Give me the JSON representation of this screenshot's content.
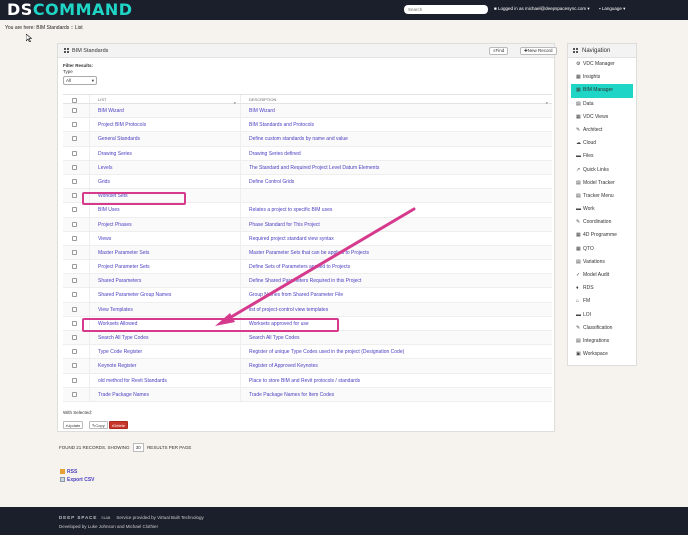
{
  "app": {
    "logo_part1": "DS",
    "logo_part2": "COMMAND",
    "search_placeholder": "Search",
    "user_text": "Logged in as michael@deepspacesync.com",
    "language_label": "Language"
  },
  "breadcrumb": {
    "prefix": "You are here:",
    "path": "BIM Standards :: List"
  },
  "panel": {
    "title": "BIM Standards",
    "find_label": "Find",
    "new_label": "New Record",
    "filter_title": "Filter Results:",
    "type_label": "Type",
    "type_value": "All"
  },
  "table": {
    "col_list": "LIST",
    "col_desc": "DESCRIPTION",
    "rows": [
      {
        "list": "BIM Wizard",
        "desc": "BIM Wizard"
      },
      {
        "list": "Project BIM Protocols",
        "desc": "BIM Standards and Protocols"
      },
      {
        "list": "General Standards",
        "desc": "Define custom standards by name and value"
      },
      {
        "list": "Drawing Series",
        "desc": "Drawing Series defined"
      },
      {
        "list": "Levels",
        "desc": "The Standard and Required Project Level Datum Elements"
      },
      {
        "list": "Grids",
        "desc": "Define Control Grids"
      },
      {
        "list": "Workset Sets",
        "desc": ""
      },
      {
        "list": "BIM Uses",
        "desc": "Relates a project to specific BIM uses"
      },
      {
        "list": "Project Phases",
        "desc": "Phase Standard for This Project"
      },
      {
        "list": "Views",
        "desc": "Required project standard view syntax"
      },
      {
        "list": "Master Parameter Sets",
        "desc": "Master Parameter Sets that can be applied to Projects"
      },
      {
        "list": "Project Parameter Sets",
        "desc": "Define Sets of Parameters applied to Projects"
      },
      {
        "list": "Shared Parameters",
        "desc": "Define Shared Parameters Required in this Project"
      },
      {
        "list": "Shared Parameter Group Names",
        "desc": "Group Names from Shared Parameter File"
      },
      {
        "list": "View Templates",
        "desc": "list of project-control view templates"
      },
      {
        "list": "Worksets Allowed",
        "desc": "Worksets approved for use"
      },
      {
        "list": "Search All Type Codes",
        "desc": "Search All Type Codes"
      },
      {
        "list": "Type Code Register",
        "desc": "Register of unique Type Codes used in the project (Designation Code)"
      },
      {
        "list": "Keynote Register",
        "desc": "Register of Approved Keynotes"
      },
      {
        "list": "old method for Revit Standards",
        "desc": "Place to store BIM and Revit protocols / standards"
      },
      {
        "list": "Trade Package Names",
        "desc": "Trade Package Names for Item Codes"
      }
    ]
  },
  "selection": {
    "with_selected": "With Selected:",
    "update": "Update",
    "copy": "Copy",
    "delete": "Delete"
  },
  "pager": {
    "found_text": "FOUND 21 RECORDS. SHOWING",
    "per_page": "30",
    "suffix": "RESULTS PER PAGE"
  },
  "exports": {
    "rss": "RSS",
    "csv": "Export CSV"
  },
  "nav": {
    "title": "Navigation",
    "items": [
      {
        "label": "VDC Manager",
        "icon": "⚙"
      },
      {
        "label": "Insights",
        "icon": "▦"
      },
      {
        "label": "BIM Manager",
        "icon": "▦"
      },
      {
        "label": "Data",
        "icon": "▤"
      },
      {
        "label": "VDC Views",
        "icon": "▦"
      },
      {
        "label": "Architect",
        "icon": "✎"
      },
      {
        "label": "Cloud",
        "icon": "☁"
      },
      {
        "label": "Files",
        "icon": "▬"
      },
      {
        "label": "Quick Links",
        "icon": "↗"
      },
      {
        "label": "Model Tracker",
        "icon": "▤"
      },
      {
        "label": "Tracker Menu",
        "icon": "▤"
      },
      {
        "label": "Work",
        "icon": "▬"
      },
      {
        "label": "Coordination",
        "icon": "✎"
      },
      {
        "label": "4D Programme",
        "icon": "▦"
      },
      {
        "label": "QTO",
        "icon": "▦"
      },
      {
        "label": "Variations",
        "icon": "▤"
      },
      {
        "label": "Model Audit",
        "icon": "✓"
      },
      {
        "label": "RDS",
        "icon": "♦"
      },
      {
        "label": "FM",
        "icon": "⌂"
      },
      {
        "label": "LOI",
        "icon": "▬"
      },
      {
        "label": "Classification",
        "icon": "✎"
      },
      {
        "label": "Integrations",
        "icon": "▤"
      },
      {
        "label": "Workspace",
        "icon": "▣"
      }
    ],
    "active_index": 2
  },
  "footer": {
    "brand": "DEEP SPACE",
    "brand_sub": "SLAB",
    "service": "Service provided by Virtual Built Technology",
    "developed": "Developed by Luke Johnson and Michael Clothier"
  },
  "colors": {
    "accent": "#1fd6c6",
    "link": "#4a3ec0",
    "highlight": "#d63a8d",
    "topbar": "#1b1e2b"
  }
}
